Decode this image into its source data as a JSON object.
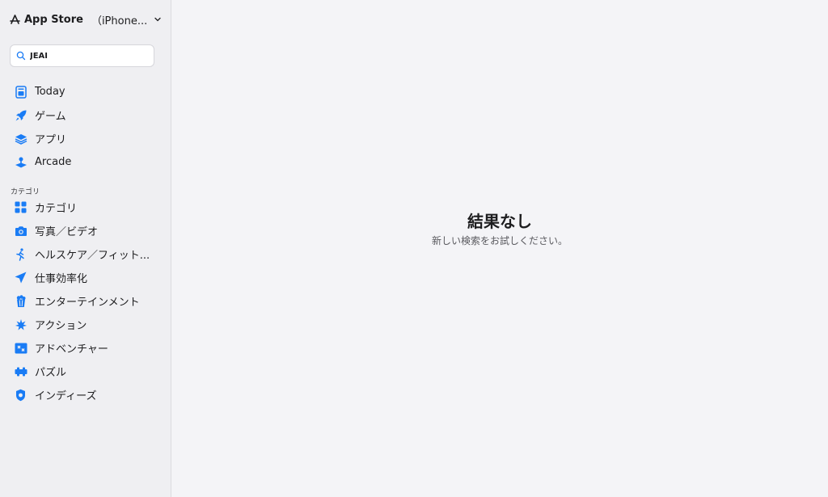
{
  "header": {
    "app_title": "App Store",
    "device": "（iPhone..."
  },
  "search": {
    "value": "JEAI",
    "placeholder": ""
  },
  "nav": {
    "items": [
      {
        "label": "Today",
        "icon": "today-icon"
      },
      {
        "label": "ゲーム",
        "icon": "rocket-icon"
      },
      {
        "label": "アプリ",
        "icon": "layers-icon"
      },
      {
        "label": "Arcade",
        "icon": "joystick-icon"
      }
    ]
  },
  "categories": {
    "section_label": "カテゴリ",
    "items": [
      {
        "label": "カテゴリ",
        "icon": "grid-icon"
      },
      {
        "label": "写真／ビデオ",
        "icon": "camera-icon"
      },
      {
        "label": "ヘルスケア／フィット...",
        "icon": "running-icon"
      },
      {
        "label": "仕事効率化",
        "icon": "paper-plane-icon"
      },
      {
        "label": "エンターテインメント",
        "icon": "popcorn-icon"
      },
      {
        "label": "アクション",
        "icon": "splash-icon"
      },
      {
        "label": "アドベンチャー",
        "icon": "map-icon"
      },
      {
        "label": "パズル",
        "icon": "puzzle-icon"
      },
      {
        "label": "インディーズ",
        "icon": "shield-icon"
      }
    ]
  },
  "main": {
    "empty_title": "結果なし",
    "empty_subtitle": "新しい検索をお試しください。"
  },
  "colors": {
    "accent": "#1a7cf5",
    "sidebar_bg": "#efeff2",
    "main_bg": "#f4f4f7"
  }
}
